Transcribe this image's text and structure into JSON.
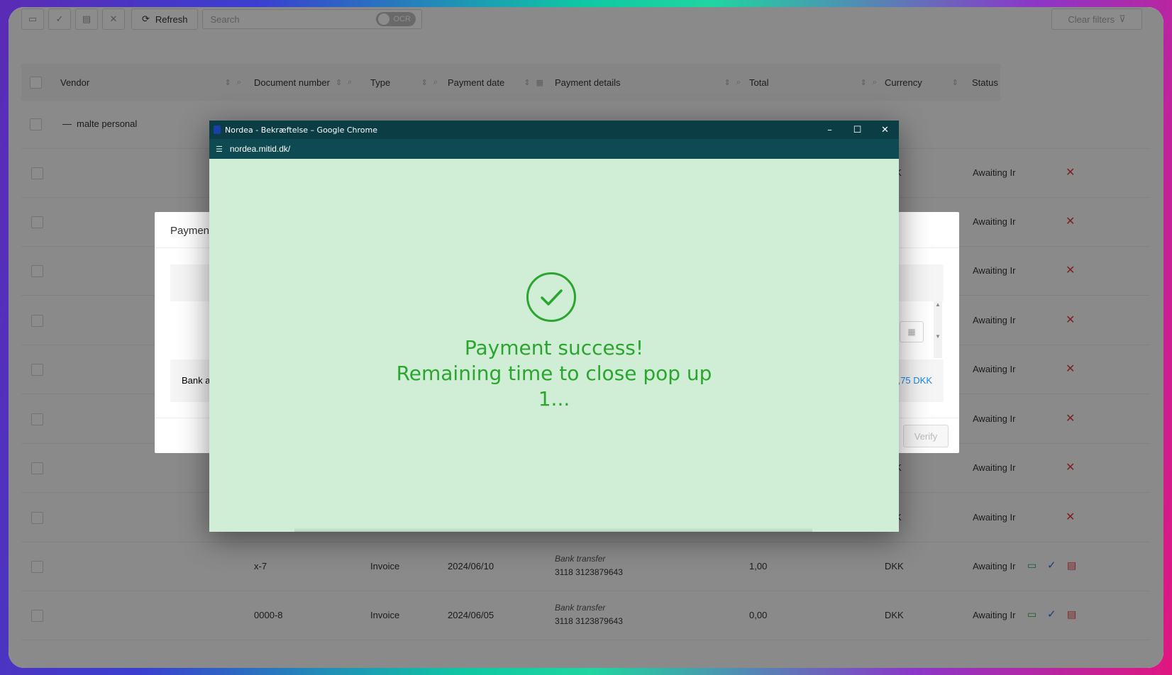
{
  "toolbar": {
    "refresh_label": "Refresh",
    "search_placeholder": "Search",
    "ocr_label": "OCR",
    "clear_filters_label": "Clear filters"
  },
  "table": {
    "columns": [
      "Vendor",
      "Document number",
      "Type",
      "Payment date",
      "Payment details",
      "Total",
      "Currency",
      "Status"
    ],
    "group_label": "malte personal",
    "hidden_rows": [
      {
        "currency_partial": "K",
        "status": "Awaiting Ir"
      },
      {
        "currency_partial": "",
        "status": "Awaiting Ir"
      },
      {
        "currency_partial": "",
        "status": "Awaiting Ir"
      },
      {
        "currency_partial": "",
        "status": "Awaiting Ir"
      },
      {
        "currency_partial": "",
        "status": "Awaiting Ir"
      },
      {
        "currency_partial": "",
        "status": "Awaiting Ir"
      },
      {
        "currency_partial": "K",
        "status": "Awaiting Ir"
      },
      {
        "currency_partial": "K",
        "status": "Awaiting Ir"
      }
    ],
    "rows": [
      {
        "document_number": "x-7",
        "type": "Invoice",
        "payment_date": "2024/06/10",
        "payment_method": "Bank transfer",
        "account": "3118 3123879643",
        "total": "1,00",
        "currency": "DKK",
        "status": "Awaiting Ir"
      },
      {
        "document_number": "0000-8",
        "type": "Invoice",
        "payment_date": "2024/06/05",
        "payment_method": "Bank transfer",
        "account": "3118 3123879643",
        "total": "0,00",
        "currency": "DKK",
        "status": "Awaiting Ir"
      }
    ]
  },
  "payment_modal": {
    "title_partial": "Paymen",
    "bank_label_partial": "Bank a",
    "amount_partial": ",75 DKK",
    "verify_label": "Verify"
  },
  "popup": {
    "window_title": "Nordea - Bekræftelse – Google Chrome",
    "url": "nordea.mitid.dk/",
    "message_line1": "Payment success!",
    "message_line2": "Remaining time to close pop up",
    "countdown": "1..."
  },
  "colors": {
    "success_green": "#2aa52e",
    "popup_bg": "#cfeed5",
    "titlebar": "#0b3d45",
    "link_blue": "#1e88e5",
    "danger_red": "#e23b3b"
  }
}
